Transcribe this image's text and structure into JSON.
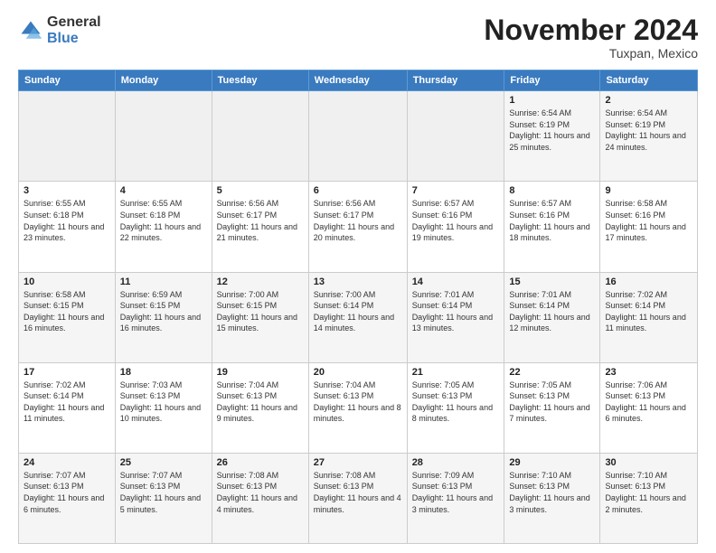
{
  "logo": {
    "general": "General",
    "blue": "Blue"
  },
  "title": "November 2024",
  "subtitle": "Tuxpan, Mexico",
  "days_header": [
    "Sunday",
    "Monday",
    "Tuesday",
    "Wednesday",
    "Thursday",
    "Friday",
    "Saturday"
  ],
  "weeks": [
    [
      {
        "day": "",
        "info": ""
      },
      {
        "day": "",
        "info": ""
      },
      {
        "day": "",
        "info": ""
      },
      {
        "day": "",
        "info": ""
      },
      {
        "day": "",
        "info": ""
      },
      {
        "day": "1",
        "info": "Sunrise: 6:54 AM\nSunset: 6:19 PM\nDaylight: 11 hours and 25 minutes."
      },
      {
        "day": "2",
        "info": "Sunrise: 6:54 AM\nSunset: 6:19 PM\nDaylight: 11 hours and 24 minutes."
      }
    ],
    [
      {
        "day": "3",
        "info": "Sunrise: 6:55 AM\nSunset: 6:18 PM\nDaylight: 11 hours and 23 minutes."
      },
      {
        "day": "4",
        "info": "Sunrise: 6:55 AM\nSunset: 6:18 PM\nDaylight: 11 hours and 22 minutes."
      },
      {
        "day": "5",
        "info": "Sunrise: 6:56 AM\nSunset: 6:17 PM\nDaylight: 11 hours and 21 minutes."
      },
      {
        "day": "6",
        "info": "Sunrise: 6:56 AM\nSunset: 6:17 PM\nDaylight: 11 hours and 20 minutes."
      },
      {
        "day": "7",
        "info": "Sunrise: 6:57 AM\nSunset: 6:16 PM\nDaylight: 11 hours and 19 minutes."
      },
      {
        "day": "8",
        "info": "Sunrise: 6:57 AM\nSunset: 6:16 PM\nDaylight: 11 hours and 18 minutes."
      },
      {
        "day": "9",
        "info": "Sunrise: 6:58 AM\nSunset: 6:16 PM\nDaylight: 11 hours and 17 minutes."
      }
    ],
    [
      {
        "day": "10",
        "info": "Sunrise: 6:58 AM\nSunset: 6:15 PM\nDaylight: 11 hours and 16 minutes."
      },
      {
        "day": "11",
        "info": "Sunrise: 6:59 AM\nSunset: 6:15 PM\nDaylight: 11 hours and 16 minutes."
      },
      {
        "day": "12",
        "info": "Sunrise: 7:00 AM\nSunset: 6:15 PM\nDaylight: 11 hours and 15 minutes."
      },
      {
        "day": "13",
        "info": "Sunrise: 7:00 AM\nSunset: 6:14 PM\nDaylight: 11 hours and 14 minutes."
      },
      {
        "day": "14",
        "info": "Sunrise: 7:01 AM\nSunset: 6:14 PM\nDaylight: 11 hours and 13 minutes."
      },
      {
        "day": "15",
        "info": "Sunrise: 7:01 AM\nSunset: 6:14 PM\nDaylight: 11 hours and 12 minutes."
      },
      {
        "day": "16",
        "info": "Sunrise: 7:02 AM\nSunset: 6:14 PM\nDaylight: 11 hours and 11 minutes."
      }
    ],
    [
      {
        "day": "17",
        "info": "Sunrise: 7:02 AM\nSunset: 6:14 PM\nDaylight: 11 hours and 11 minutes."
      },
      {
        "day": "18",
        "info": "Sunrise: 7:03 AM\nSunset: 6:13 PM\nDaylight: 11 hours and 10 minutes."
      },
      {
        "day": "19",
        "info": "Sunrise: 7:04 AM\nSunset: 6:13 PM\nDaylight: 11 hours and 9 minutes."
      },
      {
        "day": "20",
        "info": "Sunrise: 7:04 AM\nSunset: 6:13 PM\nDaylight: 11 hours and 8 minutes."
      },
      {
        "day": "21",
        "info": "Sunrise: 7:05 AM\nSunset: 6:13 PM\nDaylight: 11 hours and 8 minutes."
      },
      {
        "day": "22",
        "info": "Sunrise: 7:05 AM\nSunset: 6:13 PM\nDaylight: 11 hours and 7 minutes."
      },
      {
        "day": "23",
        "info": "Sunrise: 7:06 AM\nSunset: 6:13 PM\nDaylight: 11 hours and 6 minutes."
      }
    ],
    [
      {
        "day": "24",
        "info": "Sunrise: 7:07 AM\nSunset: 6:13 PM\nDaylight: 11 hours and 6 minutes."
      },
      {
        "day": "25",
        "info": "Sunrise: 7:07 AM\nSunset: 6:13 PM\nDaylight: 11 hours and 5 minutes."
      },
      {
        "day": "26",
        "info": "Sunrise: 7:08 AM\nSunset: 6:13 PM\nDaylight: 11 hours and 4 minutes."
      },
      {
        "day": "27",
        "info": "Sunrise: 7:08 AM\nSunset: 6:13 PM\nDaylight: 11 hours and 4 minutes."
      },
      {
        "day": "28",
        "info": "Sunrise: 7:09 AM\nSunset: 6:13 PM\nDaylight: 11 hours and 3 minutes."
      },
      {
        "day": "29",
        "info": "Sunrise: 7:10 AM\nSunset: 6:13 PM\nDaylight: 11 hours and 3 minutes."
      },
      {
        "day": "30",
        "info": "Sunrise: 7:10 AM\nSunset: 6:13 PM\nDaylight: 11 hours and 2 minutes."
      }
    ]
  ]
}
